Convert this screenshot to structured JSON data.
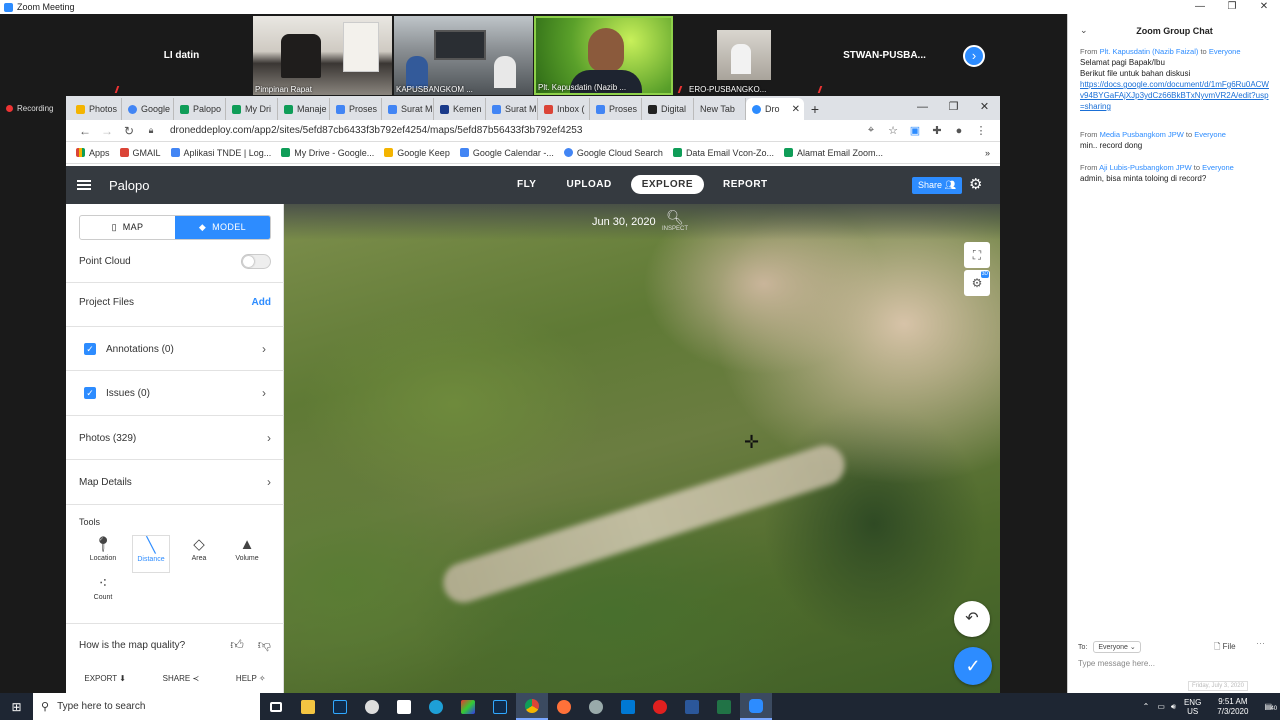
{
  "zoom": {
    "title": "Zoom Meeting",
    "recording": "Recording",
    "tiles": [
      {
        "label": "LI datin",
        "kind": "name"
      },
      {
        "label": "Pimpinan Rapat",
        "kind": "video"
      },
      {
        "label": "KAPUSBANGKOM ...",
        "kind": "video"
      },
      {
        "label": "Plt. Kapusdatin (Nazib ...",
        "kind": "video"
      },
      {
        "label": "ERO-PUSBANGKO...",
        "kind": "video"
      },
      {
        "label": "STWAN-PUSBA...",
        "kind": "name"
      }
    ]
  },
  "browser": {
    "tabs": [
      "Photos",
      "Google",
      "Palopo",
      "My Dri",
      "Manaje",
      "Proses",
      "Surat M",
      "Kemen",
      "Surat M",
      "Inbox (",
      "Proses",
      "Digital",
      "New Tab",
      "Dro"
    ],
    "url": "droneddeploy.com/app2/sites/5efd87cb6433f3b792ef4254/maps/5efd87b56433f3b792ef4253",
    "bookmarks": [
      "Apps",
      "GMAIL",
      "Aplikasi TNDE | Log...",
      "My Drive - Google...",
      "Google Keep",
      "Google Calendar -...",
      "Google Cloud Search",
      "Data Email Vcon-Zo...",
      "Alamat Email Zoom..."
    ]
  },
  "app": {
    "project": "Palopo",
    "nav": [
      "FLY",
      "UPLOAD",
      "EXPLORE",
      "REPORT"
    ],
    "active_nav": "EXPLORE",
    "share": "Share",
    "view_toggle": {
      "map": "MAP",
      "model": "MODEL"
    },
    "point_cloud": "Point Cloud",
    "project_files": "Project Files",
    "add": "Add",
    "annotations": "Annotations (0)",
    "issues": "Issues (0)",
    "photos": "Photos (329)",
    "map_details": "Map Details",
    "tools_label": "Tools",
    "tools": [
      "Location",
      "Distance",
      "Area",
      "Volume",
      "Count"
    ],
    "selected_tool": "Distance",
    "quality": "How is the map quality?",
    "footer": [
      "EXPORT",
      "SHARE",
      "HELP"
    ],
    "date": "Jun 30, 2020",
    "inspect": "INSPECT",
    "badge3d": "3D"
  },
  "chat": {
    "title": "Zoom Group Chat",
    "messages": [
      {
        "from": "Plt. Kapusdatin (Nazib Faizal)",
        "to": "Everyone",
        "lines": [
          "Selamat pagi Bapak/Ibu",
          "Berikut file untuk bahan diskusi"
        ],
        "link": "https://docs.google.com/document/d/1mFg6Ru0ACWv94BYGaFAjXJp3ydCz66BkBTxNyvmVR2A/edit?usp=sharing"
      },
      {
        "from": "Media Pusbangkom JPW",
        "to": "Everyone",
        "lines": [
          "min.. record dong"
        ]
      },
      {
        "from": "Aji Lubis-Pusbangkom JPW",
        "to": "Everyone",
        "lines": [
          "admin, bisa minta toloing di record?"
        ]
      }
    ],
    "to_label": "To:",
    "to_value": "Everyone",
    "file": "File",
    "placeholder": "Type message here...",
    "datestamp": "Friday, July 3, 2020"
  },
  "taskbar": {
    "search": "Type here to search",
    "lang": "ENG",
    "region": "US",
    "time": "9:51 AM",
    "date": "7/3/2020",
    "notif": "40"
  }
}
